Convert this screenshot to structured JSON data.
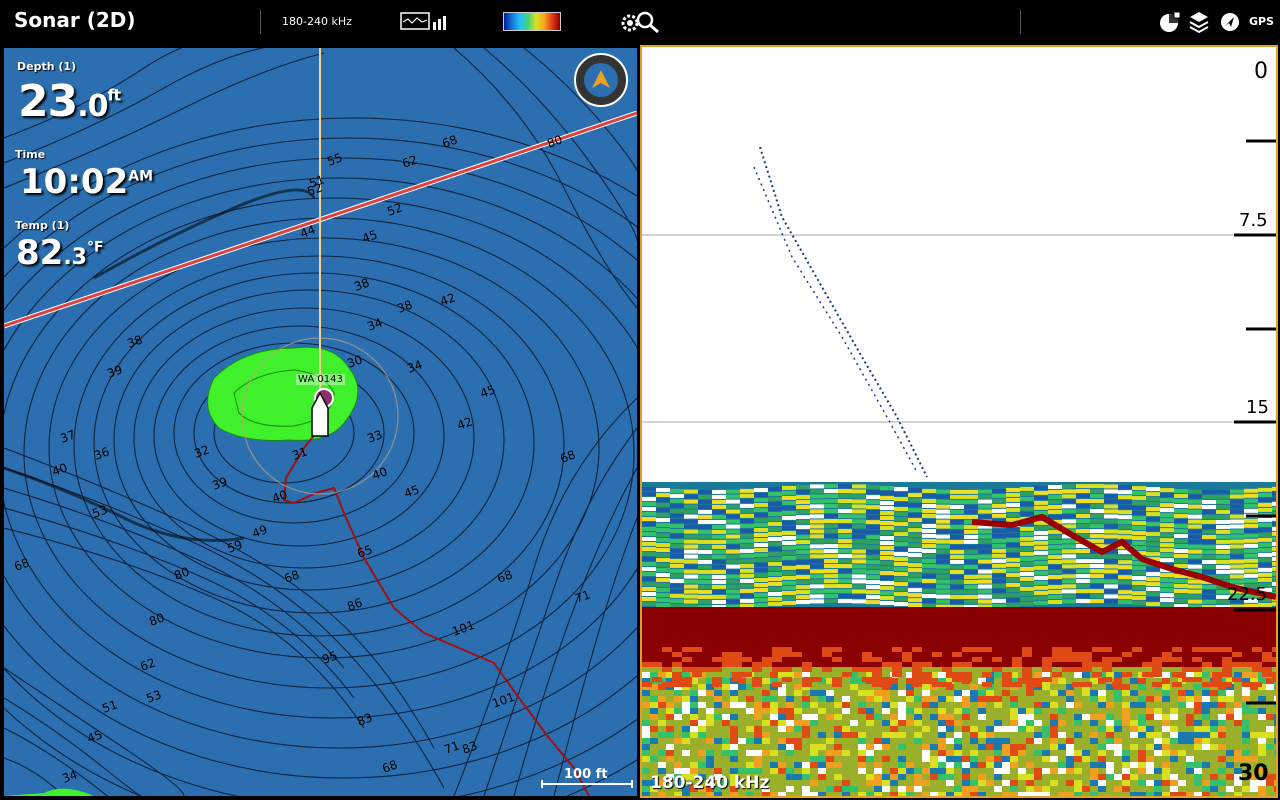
{
  "header": {
    "title": "Sonar (2D)",
    "frequency": "180-240 kHz",
    "gps_label": "GPS",
    "icons": [
      "sonar-view-icon",
      "color-palette-icon",
      "settings-search-icon",
      "alarm-icon",
      "layers-icon",
      "navigation-icon",
      "gps-icon"
    ]
  },
  "map": {
    "depth_label": "Depth (1)",
    "depth_value": "23",
    "depth_decimal": ".0",
    "depth_unit": "ft",
    "time_label": "Time",
    "time_value": "10:02",
    "time_suffix": "AM",
    "temp_label": "Temp (1)",
    "temp_value": "82",
    "temp_decimal": ".3",
    "temp_unit": "°F",
    "scale_label": "100 ft",
    "waypoint_label": "WA 0143",
    "contour_labels": [
      "68",
      "80",
      "62",
      "55",
      "52",
      "51",
      "52",
      "44",
      "45",
      "38",
      "38",
      "42",
      "34",
      "30",
      "34",
      "45",
      "42",
      "68",
      "39",
      "38",
      "37",
      "36",
      "40",
      "40",
      "39",
      "53",
      "32",
      "31",
      "33",
      "40",
      "45",
      "49",
      "59",
      "65",
      "80",
      "68",
      "71",
      "68",
      "86",
      "68",
      "80",
      "101",
      "95",
      "62",
      "53",
      "83",
      "101",
      "51",
      "45",
      "34",
      "83",
      "71",
      "68"
    ]
  },
  "sonar": {
    "depth_marks": [
      "0",
      "7.5",
      "15",
      "22.5",
      "30"
    ],
    "frequency_label": "180-240 kHz"
  },
  "colors": {
    "water": "#2b6fb0",
    "land": "#3ff02a",
    "track": "#a01010",
    "route": "#e04040",
    "border": "#e0a020",
    "bottom": "#8a0000"
  }
}
